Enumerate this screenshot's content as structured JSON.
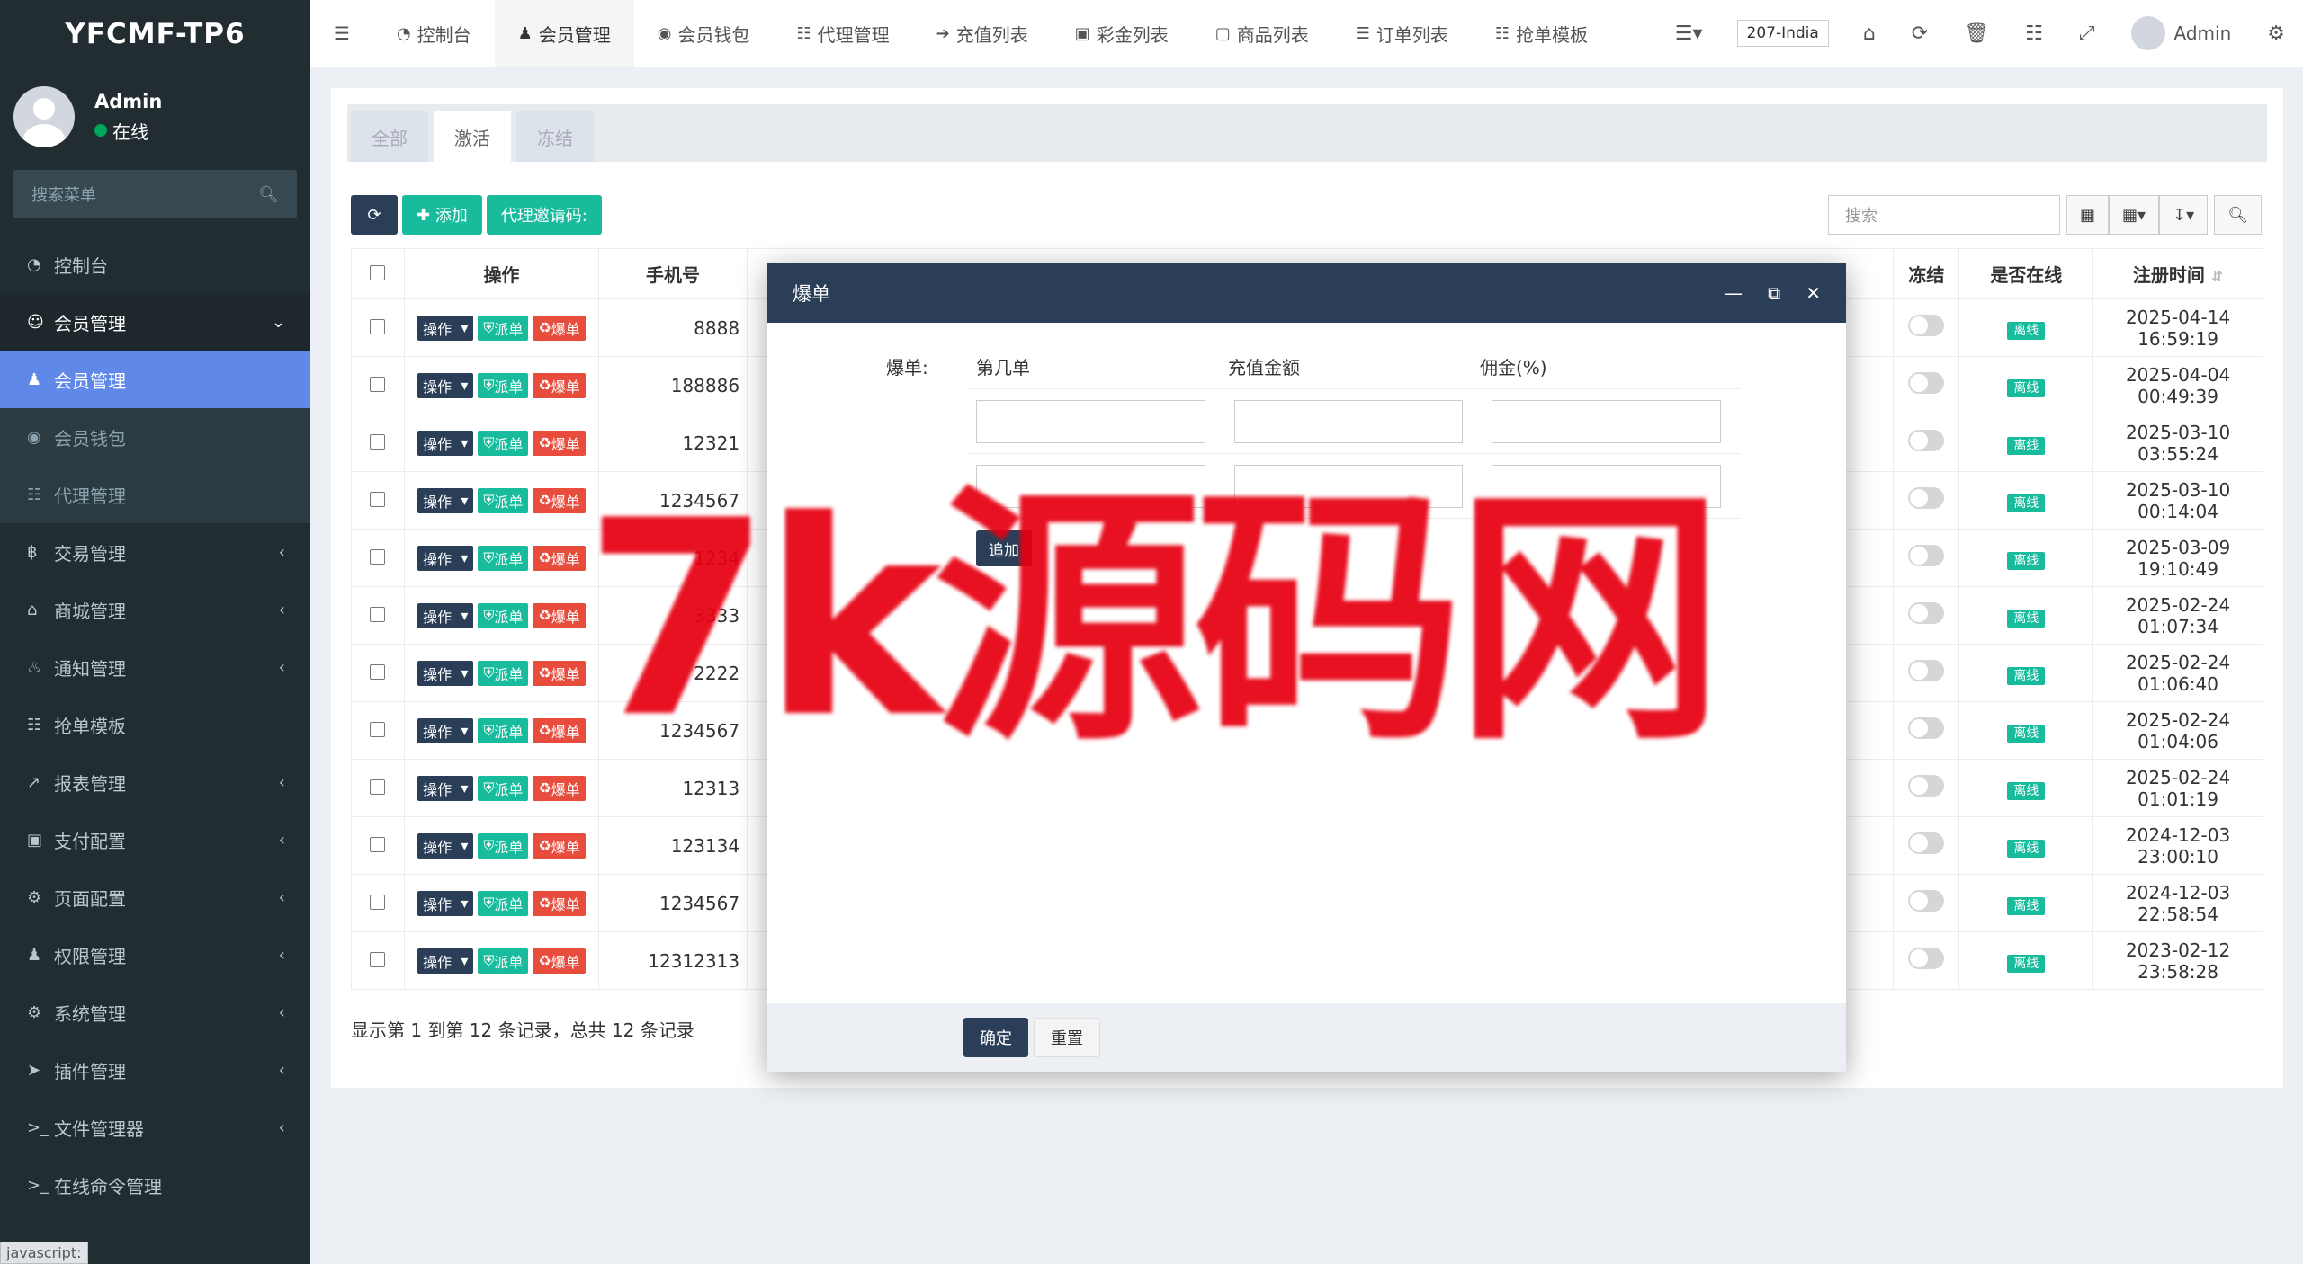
{
  "app": {
    "title": "YFCMF-TP6"
  },
  "user": {
    "name": "Admin",
    "status": "在线"
  },
  "sidebar": {
    "search_placeholder": "搜索菜单",
    "items": [
      {
        "label": "控制台",
        "icon": "dashboard-icon",
        "state": "normal"
      },
      {
        "label": "会员管理",
        "icon": "user-circle-icon",
        "state": "open"
      },
      {
        "label": "会员管理",
        "icon": "user-icon",
        "state": "active"
      },
      {
        "label": "会员钱包",
        "icon": "wallet-icon",
        "state": "sub"
      },
      {
        "label": "代理管理",
        "icon": "sitemap-icon",
        "state": "sub"
      },
      {
        "label": "交易管理",
        "icon": "bitcoin-icon",
        "state": "normal"
      },
      {
        "label": "商城管理",
        "icon": "home-icon",
        "state": "normal"
      },
      {
        "label": "通知管理",
        "icon": "bell-icon",
        "state": "normal"
      },
      {
        "label": "抢单模板",
        "icon": "sitemap-icon",
        "state": "normal"
      },
      {
        "label": "报表管理",
        "icon": "line-chart-icon",
        "state": "normal"
      },
      {
        "label": "支付配置",
        "icon": "credit-card-icon",
        "state": "normal"
      },
      {
        "label": "页面配置",
        "icon": "gear-icon",
        "state": "normal"
      },
      {
        "label": "权限管理",
        "icon": "group-icon",
        "state": "normal"
      },
      {
        "label": "系统管理",
        "icon": "cogs-icon",
        "state": "normal"
      },
      {
        "label": "插件管理",
        "icon": "rocket-icon",
        "state": "normal"
      },
      {
        "label": "文件管理器",
        "icon": "terminal-icon",
        "state": "normal"
      },
      {
        "label": "在线命令管理",
        "icon": "terminal-icon",
        "state": "normal"
      }
    ],
    "status_bar": "javascript:"
  },
  "navbar": {
    "tabs": [
      {
        "label": "控制台",
        "icon": "dashboard-icon"
      },
      {
        "label": "会员管理",
        "icon": "user-icon"
      },
      {
        "label": "会员钱包",
        "icon": "wallet-icon"
      },
      {
        "label": "代理管理",
        "icon": "sitemap-icon"
      },
      {
        "label": "充值列表",
        "icon": "sign-in-icon"
      },
      {
        "label": "彩金列表",
        "icon": "gift-icon"
      },
      {
        "label": "商品列表",
        "icon": "desktop-icon"
      },
      {
        "label": "订单列表",
        "icon": "list-icon"
      },
      {
        "label": "抢单模板",
        "icon": "sitemap-icon"
      }
    ],
    "active_tab": 1,
    "server": "207-India",
    "user": "Admin"
  },
  "filter_tabs": [
    "全部",
    "激活",
    "冻结"
  ],
  "active_filter": 1,
  "toolbar": {
    "add": "添加",
    "invite": "代理邀请码:",
    "search_placeholder": "搜索"
  },
  "table": {
    "headers": {
      "ops": "操作",
      "phone": "手机号",
      "frozen": "冻结",
      "online": "是否在线",
      "reg_time": "注册时间"
    },
    "op_labels": {
      "action": "操作",
      "dispatch": "派单",
      "burst": "爆单"
    },
    "online_label": "离线",
    "rows": [
      {
        "phone": "8888",
        "reg_time": "2025-04-14 16:59:19"
      },
      {
        "phone": "188886",
        "reg_time": "2025-04-04 00:49:39"
      },
      {
        "phone": "12321",
        "reg_time": "2025-03-10 03:55:24"
      },
      {
        "phone": "1234567",
        "reg_time": "2025-03-10 00:14:04"
      },
      {
        "phone": "1234",
        "reg_time": "2025-03-09 19:10:49"
      },
      {
        "phone": "3333",
        "reg_time": "2025-02-24 01:07:34"
      },
      {
        "phone": "2222",
        "reg_time": "2025-02-24 01:06:40"
      },
      {
        "phone": "1234567",
        "reg_time": "2025-02-24 01:04:06"
      },
      {
        "phone": "12313",
        "reg_time": "2025-02-24 01:01:19"
      },
      {
        "phone": "123134",
        "reg_time": "2024-12-03 23:00:10"
      },
      {
        "phone": "1234567",
        "reg_time": "2024-12-03 22:58:54"
      },
      {
        "phone": "12312313",
        "reg_time": "2023-02-12 23:58:28"
      }
    ],
    "footer": "显示第 1 到第 12 条记录，总共 12 条记录"
  },
  "modal": {
    "title": "爆单",
    "field_label": "爆单:",
    "columns": [
      "第几单",
      "充值金额",
      "佣金(%)"
    ],
    "add_label": "追加",
    "confirm": "确定",
    "reset": "重置"
  },
  "watermark": "7k源码网",
  "colors": {
    "sidebar": "#222d32",
    "active": "#5f88e8",
    "primary": "#2b3e57",
    "success": "#18bc9c",
    "danger": "#e74c3c"
  }
}
